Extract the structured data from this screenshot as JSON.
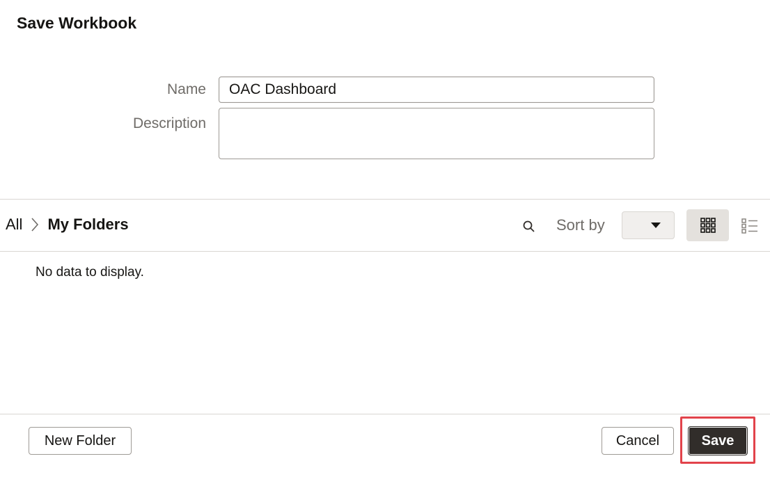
{
  "dialog": {
    "title": "Save Workbook"
  },
  "form": {
    "name_label": "Name",
    "name_value": "OAC Dashboard",
    "description_label": "Description",
    "description_value": ""
  },
  "browser": {
    "breadcrumb": {
      "root": "All",
      "current": "My Folders"
    },
    "sort_label": "Sort by",
    "sort_value": "",
    "empty_message": "No data to display.",
    "view_mode": "grid"
  },
  "footer": {
    "new_folder_label": "New Folder",
    "cancel_label": "Cancel",
    "save_label": "Save"
  },
  "colors": {
    "primary_button": "#312d2a",
    "highlight": "#e2434b",
    "label_text": "#6f6c68"
  },
  "icons": {
    "search": "search-icon",
    "breadcrumb_separator": "chevron-right-icon",
    "sort_dropdown": "caret-down-icon",
    "grid_view": "grid-view-icon",
    "list_view": "list-view-icon"
  }
}
